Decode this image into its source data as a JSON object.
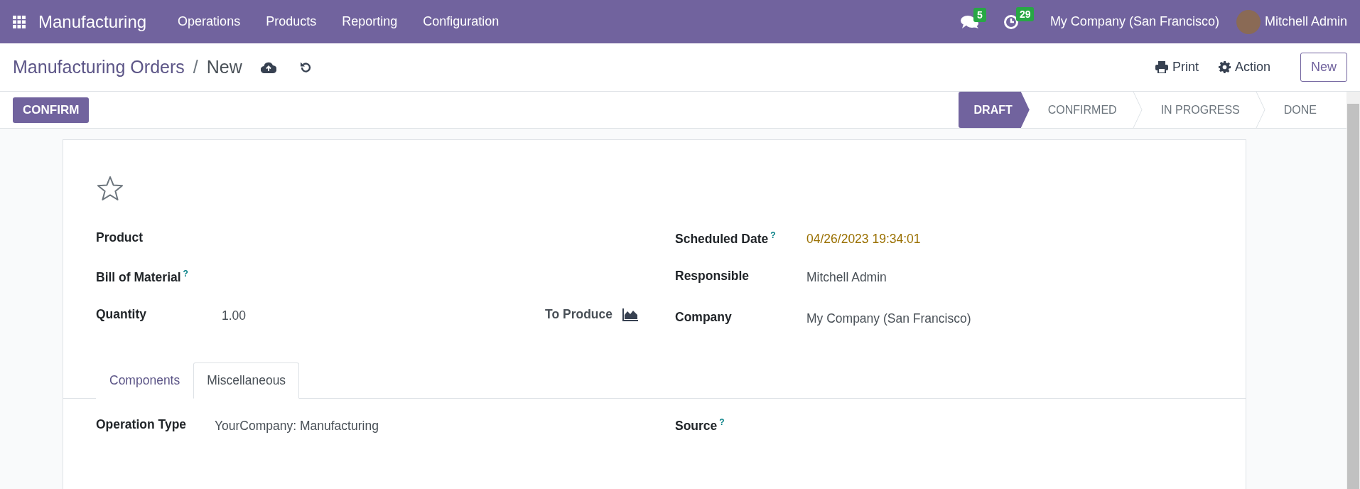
{
  "navbar": {
    "app_name": "Manufacturing",
    "menu": [
      "Operations",
      "Products",
      "Reporting",
      "Configuration"
    ],
    "messages_count": "5",
    "activities_count": "29",
    "company": "My Company (San Francisco)",
    "user": "Mitchell Admin"
  },
  "control_panel": {
    "breadcrumb": [
      "Manufacturing Orders",
      "New"
    ],
    "separator": "/",
    "print": "Print",
    "action": "Action",
    "new": "New"
  },
  "status_bar": {
    "confirm": "CONFIRM",
    "stages": [
      {
        "label": "DRAFT",
        "selected": true
      },
      {
        "label": "CONFIRMED",
        "selected": false
      },
      {
        "label": "IN PROGRESS",
        "selected": false
      },
      {
        "label": "DONE",
        "selected": false
      }
    ]
  },
  "form": {
    "starred": false,
    "left_fields": [
      {
        "label": "Product"
      },
      {
        "label": "Bill of Material",
        "help": "?"
      },
      {
        "label": "Quantity",
        "value": "1.00",
        "unit_label": "To Produce"
      }
    ],
    "right_fields": [
      {
        "label": "Scheduled Date",
        "help": "?",
        "value": "04/26/2023 19:34:01",
        "highlight": true
      },
      {
        "label": "Responsible",
        "value": "Mitchell Admin",
        "highlight": false
      },
      {
        "label": "Company",
        "value": "My Company (San Francisco)",
        "highlight": false
      }
    ],
    "tabs": [
      {
        "label": "Components",
        "selected": false
      },
      {
        "label": "Miscellaneous",
        "selected": true
      }
    ],
    "misc_left": [
      {
        "label": "Operation Type",
        "value": "YourCompany: Manufacturing"
      }
    ],
    "misc_right": [
      {
        "label": "Source",
        "help": "?"
      }
    ]
  }
}
